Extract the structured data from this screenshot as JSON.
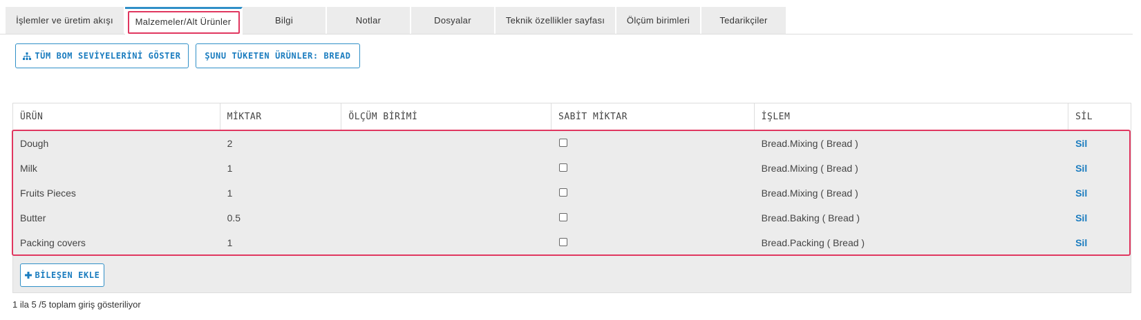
{
  "tabs": [
    {
      "label": "İşlemler ve üretim akışı",
      "active": false
    },
    {
      "label": "Malzemeler/Alt Ürünler",
      "active": true
    },
    {
      "label": "Bilgi",
      "active": false
    },
    {
      "label": "Notlar",
      "active": false
    },
    {
      "label": "Dosyalar",
      "active": false
    },
    {
      "label": "Teknik özellikler sayfası",
      "active": false
    },
    {
      "label": "Ölçüm birimleri",
      "active": false
    },
    {
      "label": "Tedarikçiler",
      "active": false
    }
  ],
  "actions": {
    "show_bom_label": "TÜM BOM SEVİYELERİNİ GÖSTER",
    "consuming_products_label": "ŞUNU TÜKETEN ÜRÜNLER: BREAD",
    "add_component_label": "BİLEŞEN EKLE"
  },
  "table": {
    "columns": [
      "ÜRÜN",
      "MİKTAR",
      "ÖLÇÜM BİRİMİ",
      "SABİT MİKTAR",
      "İŞLEM",
      "SİL"
    ],
    "rows": [
      {
        "product": "Dough",
        "quantity": "2",
        "unit": "",
        "fixed": false,
        "operation": "Bread.Mixing ( Bread )",
        "delete": "Sil"
      },
      {
        "product": "Milk",
        "quantity": "1",
        "unit": "",
        "fixed": false,
        "operation": "Bread.Mixing ( Bread )",
        "delete": "Sil"
      },
      {
        "product": "Fruits Pieces",
        "quantity": "1",
        "unit": "",
        "fixed": false,
        "operation": "Bread.Mixing ( Bread )",
        "delete": "Sil"
      },
      {
        "product": "Butter",
        "quantity": "0.5",
        "unit": "",
        "fixed": false,
        "operation": "Bread.Baking ( Bread )",
        "delete": "Sil"
      },
      {
        "product": "Packing covers",
        "quantity": "1",
        "unit": "",
        "fixed": false,
        "operation": "Bread.Packing ( Bread )",
        "delete": "Sil"
      }
    ]
  },
  "footer": {
    "summary": "1 ila 5 /5 toplam giriş gösteriliyor"
  },
  "colors": {
    "accent": "#1a7cbf",
    "highlight": "#e0365f",
    "tab_bg": "#ececec"
  },
  "icons": {
    "show_bom": "sitemap-icon",
    "add": "plus-icon"
  }
}
